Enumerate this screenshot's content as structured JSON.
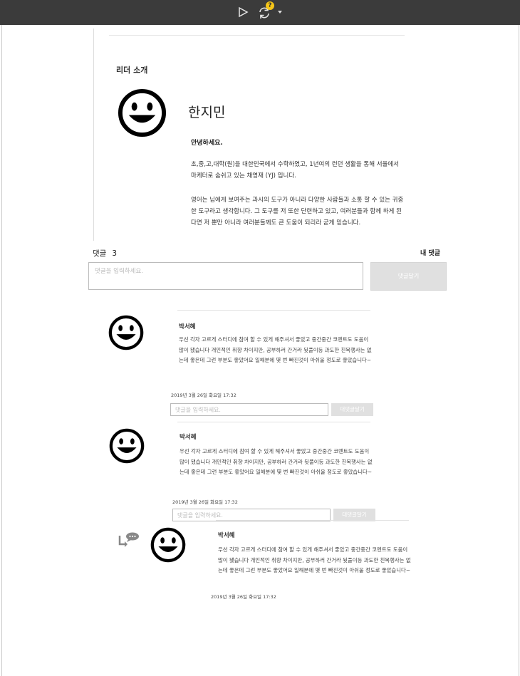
{
  "toolbar": {
    "play_icon": "play-icon",
    "sync_icon": "sync-icon",
    "help_badge": "?"
  },
  "leader": {
    "section_title": "리더 소개",
    "avatar_icon": "smiley-icon",
    "name": "한지민",
    "greeting": "안녕하세요.",
    "paragraph1": "초,중,고,대학(원)을 대한민국에서 수학하였고, 1년여의 런던 생활을 통해 서울에서 마케터로 숨쉬고 있는 채영재 (YJ) 입니다.",
    "paragraph2": "영어는 님에게 보여주는 과시의 도구가 아니라 다양한 사람들과 소통 할 수 있는 귀중한 도구라고 생각합니다. 그 도구를 저 또한 단련하고 있고, 여러분들과 함께 하게 된다면 저 뿐만 아니라 여러분들께도 큰 도움이 되리라 굳게 믿습니다."
  },
  "comments_section": {
    "label": "댓글",
    "count": "3",
    "my_comments": "내 댓글",
    "input_placeholder": "댓글을 입력하세요.",
    "submit_label": "댓글달기"
  },
  "comments": [
    {
      "author": "박서혜",
      "text": "우선 각자 고르게 스터디에 참여 할 수 있게 해주셔서 좋았고 중간중간 코멘트도 도움이 많이 됐습니다 개인적인 취향 차이지만, 공부하러 간거라 뒷풀이등 과도한 친목행사는 없는데 좋은데 그런 부분도 좋았어요 일해분에 몇 번 빠진것이 아쉬울 정도로 좋았습니다~",
      "date": "2019년 3월 26일 화요일 17:32",
      "reply_placeholder": "댓글을 입력하세요.",
      "reply_button": "대댓글달기"
    },
    {
      "author": "박서혜",
      "text": "우선 각자 고르게 스터디에 참여 할 수 있게 해주셔서 좋았고 중간중간 코멘트도 도움이 많이 됐습니다 개인적인 취향 차이지만, 공부하러 간거라 뒷풀이등 과도한 친목행사는 없는데 좋은데 그런 부분도 좋았어요 일해분에 몇 번 빠진것이 아쉬울 정도로 좋았습니다~",
      "date": "2019년 3월 26일 화요일 17:32",
      "reply_placeholder": "댓글을 입력하세요.",
      "reply_button": "대댓글달기"
    },
    {
      "author": "박서혜",
      "text": "우선 각자 고르게 스터디에 참여 할 수 있게 해주셔서 좋았고 중간중간 코멘트도 도움이 많이 됐습니다 개인적인 취향 차이지만, 공부하러 간거라 뒷풀이등 과도한 친목행사는 없는데 좋은데 그런 부분도 좋았어요 일해분에 몇 번 빠진것이 아쉬울 정도로 좋았습니다~",
      "date": "2019년 3월 26일 화요일 17:32",
      "reply_icon": "reply-comment-icon"
    }
  ]
}
